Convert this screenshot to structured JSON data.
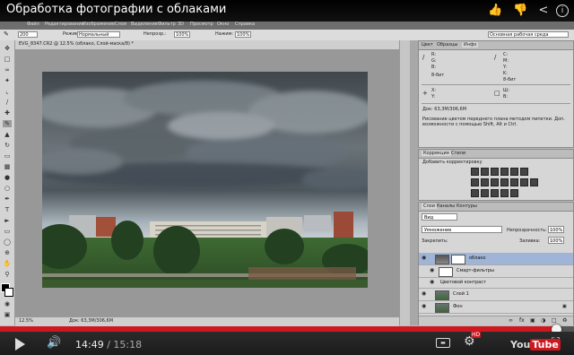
{
  "video": {
    "title": "Обработка фотографии с облаками",
    "time_current": "14:49",
    "time_separator": " / ",
    "time_total": "15:18",
    "progress_fraction": 0.969,
    "hd_badge": "HD",
    "logo_you": "You",
    "logo_tube": "Tube",
    "accent": "#cc181e"
  },
  "ps": {
    "menu": [
      "Файл",
      "Редактирование",
      "Изображение",
      "Слои",
      "Выделение",
      "Фильтр",
      "3D",
      "Просмотр",
      "Окно",
      "Справка"
    ],
    "options": {
      "size": "200",
      "mode_label": "Режим:",
      "mode_value": "Нормальный",
      "opacity_label": "Непрозр.:",
      "opacity_value": "100%",
      "flow_label": "Нажим:",
      "flow_value": "100%",
      "workspace": "Основная рабочая среда"
    },
    "document_tab": "EVG_8347.CR2 @ 12.5% (облако, Слой-маска/8) *",
    "status_zoom": "12.5%",
    "status_doc": "Док: 63,3M/306,6M",
    "info_panel": {
      "tabs": [
        "Цвет",
        "Образцы",
        "Инфо"
      ],
      "r_label": "R:",
      "g_label": "G:",
      "b_label": "B:",
      "c_label": "C:",
      "m_label": "M:",
      "y_label": "Y:",
      "k_label": "K:",
      "bit_left": "8-бит",
      "bit_right": "8-бит",
      "x_label": "X:",
      "y2_label": "Y:",
      "w_label": "Ш:",
      "h_label": "В:",
      "doc": "Док: 63,3M/306,6M",
      "hint": "Рисование цветом переднего плана методом пипетки. Доп. возможности с помощью Shift, Alt и Ctrl."
    },
    "adjustments_panel": {
      "tabs": [
        "Коррекция",
        "Стили"
      ],
      "title": "Добавить корректировку"
    },
    "layers_panel": {
      "tabs": [
        "Слои",
        "Каналы",
        "Контуры"
      ],
      "kind": "Вид",
      "blend_mode": "Умножение",
      "opacity_label": "Непрозрачность:",
      "opacity_value": "100%",
      "lock_label": "Закрепить:",
      "fill_label": "Заливка:",
      "fill_value": "100%",
      "layers": [
        {
          "name": "облако",
          "selected": true
        },
        {
          "name": "Смарт-фильтры",
          "selected": false
        },
        {
          "name": "Цветовой контраст",
          "selected": false
        },
        {
          "name": "Слой 1",
          "selected": false
        },
        {
          "name": "Фон",
          "selected": false
        }
      ]
    }
  }
}
